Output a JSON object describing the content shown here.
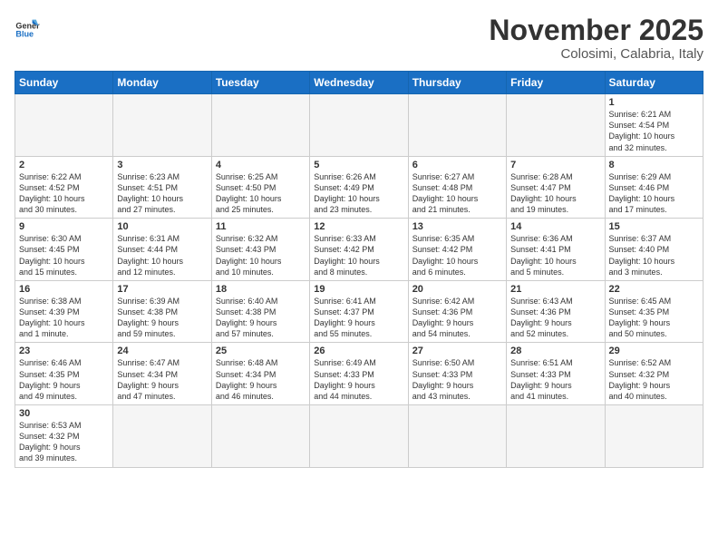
{
  "logo": {
    "text_general": "General",
    "text_blue": "Blue"
  },
  "title": "November 2025",
  "location": "Colosimi, Calabria, Italy",
  "days_of_week": [
    "Sunday",
    "Monday",
    "Tuesday",
    "Wednesday",
    "Thursday",
    "Friday",
    "Saturday"
  ],
  "weeks": [
    [
      {
        "day": "",
        "info": ""
      },
      {
        "day": "",
        "info": ""
      },
      {
        "day": "",
        "info": ""
      },
      {
        "day": "",
        "info": ""
      },
      {
        "day": "",
        "info": ""
      },
      {
        "day": "",
        "info": ""
      },
      {
        "day": "1",
        "info": "Sunrise: 6:21 AM\nSunset: 4:54 PM\nDaylight: 10 hours\nand 32 minutes."
      }
    ],
    [
      {
        "day": "2",
        "info": "Sunrise: 6:22 AM\nSunset: 4:52 PM\nDaylight: 10 hours\nand 30 minutes."
      },
      {
        "day": "3",
        "info": "Sunrise: 6:23 AM\nSunset: 4:51 PM\nDaylight: 10 hours\nand 27 minutes."
      },
      {
        "day": "4",
        "info": "Sunrise: 6:25 AM\nSunset: 4:50 PM\nDaylight: 10 hours\nand 25 minutes."
      },
      {
        "day": "5",
        "info": "Sunrise: 6:26 AM\nSunset: 4:49 PM\nDaylight: 10 hours\nand 23 minutes."
      },
      {
        "day": "6",
        "info": "Sunrise: 6:27 AM\nSunset: 4:48 PM\nDaylight: 10 hours\nand 21 minutes."
      },
      {
        "day": "7",
        "info": "Sunrise: 6:28 AM\nSunset: 4:47 PM\nDaylight: 10 hours\nand 19 minutes."
      },
      {
        "day": "8",
        "info": "Sunrise: 6:29 AM\nSunset: 4:46 PM\nDaylight: 10 hours\nand 17 minutes."
      }
    ],
    [
      {
        "day": "9",
        "info": "Sunrise: 6:30 AM\nSunset: 4:45 PM\nDaylight: 10 hours\nand 15 minutes."
      },
      {
        "day": "10",
        "info": "Sunrise: 6:31 AM\nSunset: 4:44 PM\nDaylight: 10 hours\nand 12 minutes."
      },
      {
        "day": "11",
        "info": "Sunrise: 6:32 AM\nSunset: 4:43 PM\nDaylight: 10 hours\nand 10 minutes."
      },
      {
        "day": "12",
        "info": "Sunrise: 6:33 AM\nSunset: 4:42 PM\nDaylight: 10 hours\nand 8 minutes."
      },
      {
        "day": "13",
        "info": "Sunrise: 6:35 AM\nSunset: 4:42 PM\nDaylight: 10 hours\nand 6 minutes."
      },
      {
        "day": "14",
        "info": "Sunrise: 6:36 AM\nSunset: 4:41 PM\nDaylight: 10 hours\nand 5 minutes."
      },
      {
        "day": "15",
        "info": "Sunrise: 6:37 AM\nSunset: 4:40 PM\nDaylight: 10 hours\nand 3 minutes."
      }
    ],
    [
      {
        "day": "16",
        "info": "Sunrise: 6:38 AM\nSunset: 4:39 PM\nDaylight: 10 hours\nand 1 minute."
      },
      {
        "day": "17",
        "info": "Sunrise: 6:39 AM\nSunset: 4:38 PM\nDaylight: 9 hours\nand 59 minutes."
      },
      {
        "day": "18",
        "info": "Sunrise: 6:40 AM\nSunset: 4:38 PM\nDaylight: 9 hours\nand 57 minutes."
      },
      {
        "day": "19",
        "info": "Sunrise: 6:41 AM\nSunset: 4:37 PM\nDaylight: 9 hours\nand 55 minutes."
      },
      {
        "day": "20",
        "info": "Sunrise: 6:42 AM\nSunset: 4:36 PM\nDaylight: 9 hours\nand 54 minutes."
      },
      {
        "day": "21",
        "info": "Sunrise: 6:43 AM\nSunset: 4:36 PM\nDaylight: 9 hours\nand 52 minutes."
      },
      {
        "day": "22",
        "info": "Sunrise: 6:45 AM\nSunset: 4:35 PM\nDaylight: 9 hours\nand 50 minutes."
      }
    ],
    [
      {
        "day": "23",
        "info": "Sunrise: 6:46 AM\nSunset: 4:35 PM\nDaylight: 9 hours\nand 49 minutes."
      },
      {
        "day": "24",
        "info": "Sunrise: 6:47 AM\nSunset: 4:34 PM\nDaylight: 9 hours\nand 47 minutes."
      },
      {
        "day": "25",
        "info": "Sunrise: 6:48 AM\nSunset: 4:34 PM\nDaylight: 9 hours\nand 46 minutes."
      },
      {
        "day": "26",
        "info": "Sunrise: 6:49 AM\nSunset: 4:33 PM\nDaylight: 9 hours\nand 44 minutes."
      },
      {
        "day": "27",
        "info": "Sunrise: 6:50 AM\nSunset: 4:33 PM\nDaylight: 9 hours\nand 43 minutes."
      },
      {
        "day": "28",
        "info": "Sunrise: 6:51 AM\nSunset: 4:33 PM\nDaylight: 9 hours\nand 41 minutes."
      },
      {
        "day": "29",
        "info": "Sunrise: 6:52 AM\nSunset: 4:32 PM\nDaylight: 9 hours\nand 40 minutes."
      }
    ],
    [
      {
        "day": "30",
        "info": "Sunrise: 6:53 AM\nSunset: 4:32 PM\nDaylight: 9 hours\nand 39 minutes."
      },
      {
        "day": "",
        "info": ""
      },
      {
        "day": "",
        "info": ""
      },
      {
        "day": "",
        "info": ""
      },
      {
        "day": "",
        "info": ""
      },
      {
        "day": "",
        "info": ""
      },
      {
        "day": "",
        "info": ""
      }
    ]
  ]
}
